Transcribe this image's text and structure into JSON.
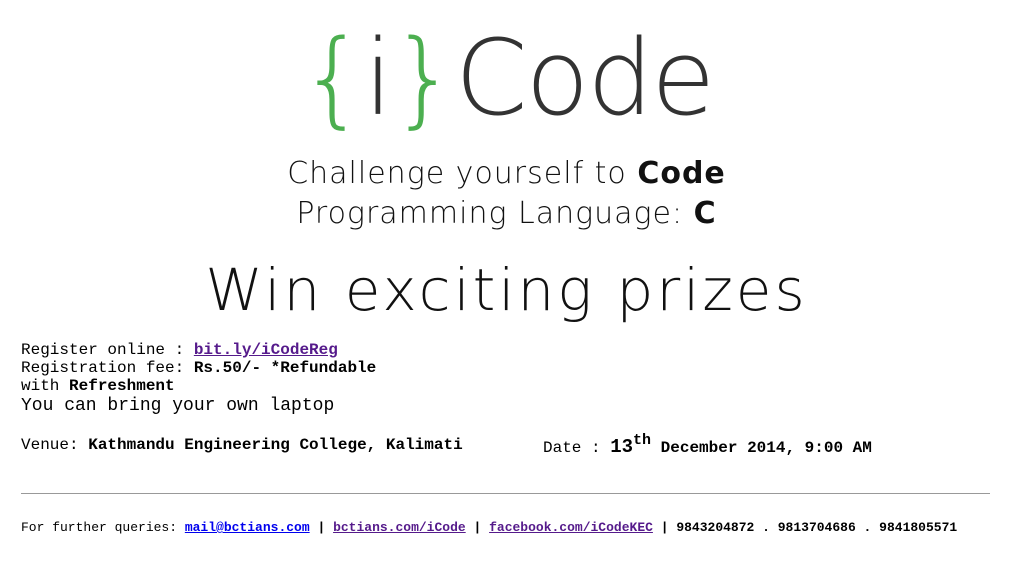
{
  "logo": {
    "open_brace": "{",
    "letter": "i",
    "close_brace": "}",
    "word": "Code",
    "brace_color": "#4caf50"
  },
  "tagline": {
    "line1_prefix": "Challenge yourself to ",
    "line1_bold": "Code",
    "line2_prefix": "Programming Language: ",
    "line2_bold": "C"
  },
  "headline": "Win exciting prizes",
  "register": {
    "label": "Register online : ",
    "link": "bit.ly/iCodeReg"
  },
  "fee": {
    "label": "Registration fee: ",
    "value": "Rs.50/- *Refundable",
    "with_label": "with ",
    "with_value": "Refreshment"
  },
  "laptop_note": "You can bring your own laptop",
  "venue": {
    "label": "Venue: ",
    "value": "Kathmandu Engineering College, Kalimati"
  },
  "date": {
    "label": "Date : ",
    "day": "13",
    "suffix": "th",
    "rest": " December 2014, 9:00 AM"
  },
  "footer": {
    "label": "For further queries: ",
    "email": "mail@bctians.com",
    "sep1": " | ",
    "site": "bctians.com/iCode",
    "sep2": " | ",
    "facebook": "facebook.com/iCodeKEC",
    "sep3": " | ",
    "phones": "9843204872 . 9813704686 . 9841805571"
  }
}
